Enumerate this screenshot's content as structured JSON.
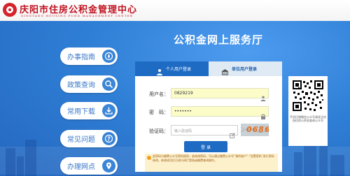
{
  "header": {
    "title_cn": "庆阳市住房公积金管理中心",
    "title_en": "QINGYANG HOUSING FUND MANAGEMENT CENTER"
  },
  "service_title": "公积金网上服务厅",
  "nav": {
    "items": [
      {
        "label": "办事指南",
        "icon": "compass-icon"
      },
      {
        "label": "政策查询",
        "icon": "search-icon"
      },
      {
        "label": "常用下载",
        "icon": "download-icon"
      },
      {
        "label": "常见问题",
        "icon": "question-icon"
      },
      {
        "label": "办理网点",
        "icon": "location-icon"
      }
    ]
  },
  "login": {
    "tab_personal": "个人用户登录",
    "tab_unit": "单位用户登录",
    "username_label": "用户名：",
    "username_value": "0829219",
    "password_label": "密　码：",
    "password_value": "•••••••",
    "captcha_label": "验证码：",
    "captcha_placeholder": "输入验证码",
    "captcha_code": "0686",
    "login_button": "登 录",
    "notice": "此密码与缴费公众号密码相同，若修改密码，可以通过缴费公众号“我的账户”-“设置密码”进行密码修改，修改成功后可进行网厅登陆或缴费查询操作。"
  },
  "qr": {
    "caption": "手机扫描微信公众号请关注庆阳住房公积金查询公众号"
  },
  "colors": {
    "background": "#2f7fd6",
    "accent": "#1e6bc4",
    "title_red": "#c1121f",
    "input_yellow": "#fbfcc8"
  }
}
